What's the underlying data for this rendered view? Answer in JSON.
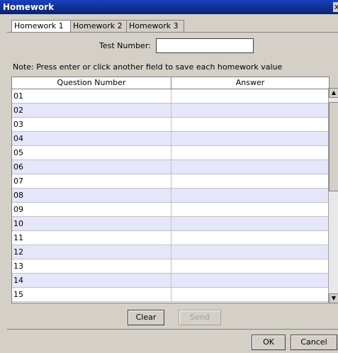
{
  "window": {
    "title": "Homework",
    "close_glyph": "x"
  },
  "tabs": [
    "Homework 1",
    "Homework 2",
    "Homework 3"
  ],
  "test_number": {
    "label": "Test Number:",
    "value": ""
  },
  "note": "Note: Press enter or click another field to save each homework value",
  "table": {
    "columns": [
      "Question Number",
      "Answer"
    ],
    "rows": [
      [
        "01",
        ""
      ],
      [
        "02",
        ""
      ],
      [
        "03",
        ""
      ],
      [
        "04",
        ""
      ],
      [
        "05",
        ""
      ],
      [
        "06",
        ""
      ],
      [
        "07",
        ""
      ],
      [
        "08",
        ""
      ],
      [
        "09",
        ""
      ],
      [
        "10",
        ""
      ],
      [
        "11",
        ""
      ],
      [
        "12",
        ""
      ],
      [
        "13",
        ""
      ],
      [
        "14",
        ""
      ],
      [
        "15",
        ""
      ]
    ]
  },
  "actions": {
    "clear": "Clear",
    "send": "Send"
  },
  "dialog": {
    "ok": "OK",
    "cancel": "Cancel"
  },
  "colors": {
    "titlebar": "#0a246a",
    "alt_row": "#e6e6fa",
    "window_bg": "#d4d0c8"
  }
}
